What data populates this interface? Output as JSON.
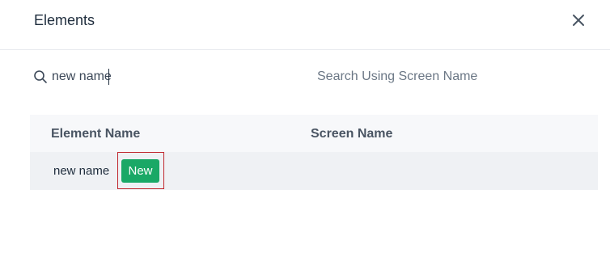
{
  "dialog": {
    "title": "Elements",
    "close_icon": "close-icon"
  },
  "search": {
    "element_value": "new name",
    "element_icon": "search-icon",
    "screen_placeholder": "Search Using Screen Name"
  },
  "table": {
    "columns": [
      "Element Name",
      "Screen Name"
    ],
    "rows": [
      {
        "element_name": "new name",
        "badge": "New",
        "screen_name": ""
      }
    ]
  },
  "colors": {
    "badge_bg": "#1aa866",
    "highlight_border": "#c0262d"
  }
}
